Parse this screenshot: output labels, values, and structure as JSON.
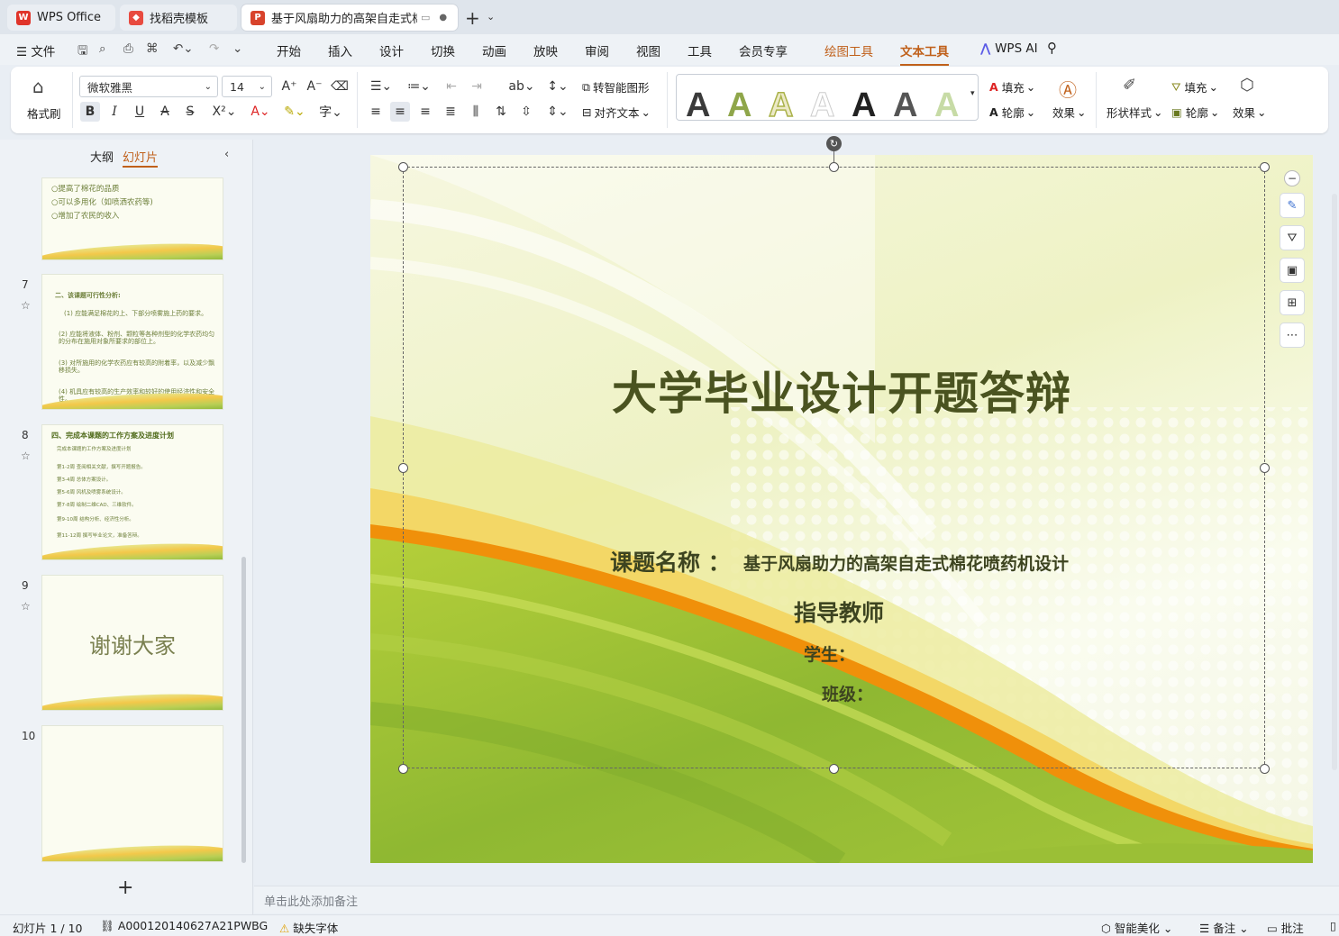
{
  "tabs": [
    {
      "label": "WPS Office"
    },
    {
      "label": "找稻壳模板"
    },
    {
      "label": "基于风扇助力的高架自走式棉"
    }
  ],
  "menu": {
    "file": "文件",
    "items": [
      "开始",
      "插入",
      "设计",
      "切换",
      "动画",
      "放映",
      "审阅",
      "视图",
      "工具",
      "会员专享"
    ],
    "tools": [
      "绘图工具",
      "文本工具"
    ],
    "wps_ai": "WPS AI"
  },
  "ribbon": {
    "format_painter": "格式刷",
    "font_name": "微软雅黑",
    "font_size": "14",
    "to_smart_graphic": "转智能图形",
    "align_text": "对齐文本",
    "fill": "填充",
    "outline": "轮廓",
    "effect": "效果",
    "shape_style": "形状样式",
    "shape_fill": "填充",
    "shape_outline": "轮廓",
    "shape_effect": "效果",
    "wordart_glyph": "A"
  },
  "panel": {
    "tab_outline": "大纲",
    "tab_slides": "幻灯片",
    "thumb6_lines": [
      "○提高了棉花的品质",
      "○可以多用化（如喷洒农药等)",
      "○增加了农民的收入"
    ],
    "thumb7_number": "7",
    "thumb7_lines": [
      "二、该课题可行性分析:",
      "(1) 应能满足棉花的上、下部分喷雾施上药的要求。",
      "(2) 应能将液体、粉剂、颗粒等各种剂型的化学农药均匀的分布在施用对象所要求的部位上。",
      "(3) 对所施用的化学农药应有较高的附着率，以及减少飘移损失。",
      "(4) 机具应有较高的生产效率和较好的使用经济性和安全性。"
    ],
    "thumb8_number": "8",
    "thumb8_title": "四、完成本课题的工作方案及进度计划",
    "thumb8_lines": [
      "完成本课题的工作方案及进度计划",
      "第1-2周 查阅相关文献，撰写开题报告。",
      "第3-4周 总体方案设计。",
      "第5-6周 风机及喷雾系统设计。",
      "第7-8周 绘制二维CAD、三维软件。",
      "第9-10周 结构分析、经济性分析。",
      "第11-12周 撰写毕业论文，准备答辩。"
    ],
    "thumb9_number": "9",
    "thumb9_text": "谢谢大家",
    "thumb10_number": "10",
    "add_slide": "+"
  },
  "slide": {
    "title": "大学毕业设计开题答辩",
    "topic_label": "课题名称 ：",
    "topic_value": "基于风扇助力的高架自走式棉花喷药机设计",
    "advisor": "指导教师",
    "student": "学生：",
    "class": "班级："
  },
  "notes_placeholder": "单击此处添加备注",
  "status": {
    "slide_count": "幻灯片 1 / 10",
    "doc_id": "A000120140627A21PWBG",
    "missing_font": "缺失字体",
    "smart_beautify": "智能美化",
    "notes": "备注",
    "comments": "批注"
  },
  "colors": {
    "accent_orange": "#c0601a",
    "slide_title": "#4a5320",
    "wps_red": "#e0342a"
  }
}
